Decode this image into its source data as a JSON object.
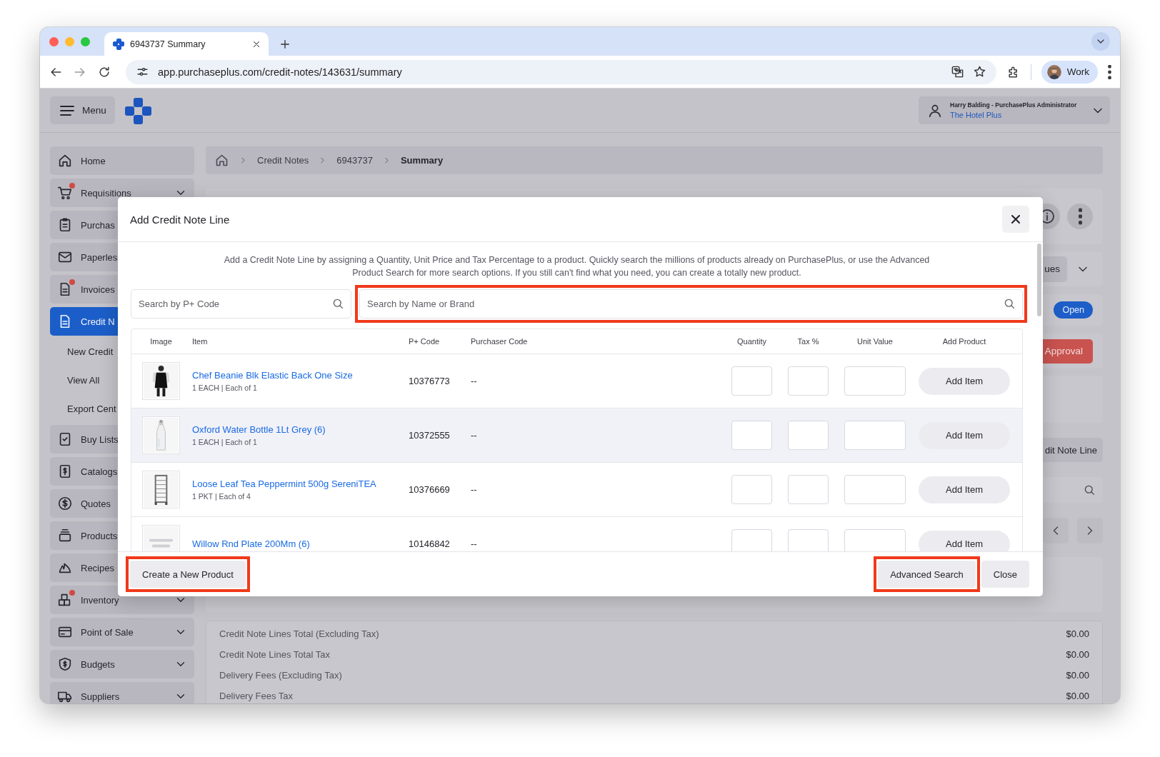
{
  "browser": {
    "tab": {
      "title": "6943737 Summary",
      "selected": true
    },
    "url": "app.purchaseplus.com/credit-notes/143631/summary",
    "profile": "Work"
  },
  "header": {
    "menu": "Menu",
    "user_name": "Harry Balding - PurchasePlus Administrator",
    "organisation": "The Hotel Plus"
  },
  "sidebar": {
    "items": [
      {
        "label": "Home",
        "selected": false,
        "alert": false,
        "chevron": false
      },
      {
        "label": "Requisitions",
        "selected": false,
        "alert": true,
        "chevron": true
      },
      {
        "label": "Purchas",
        "selected": false,
        "alert": false,
        "chevron": false
      },
      {
        "label": "Paperles",
        "selected": false,
        "alert": false,
        "chevron": false
      },
      {
        "label": "Invoices",
        "selected": false,
        "alert": true,
        "chevron": false
      },
      {
        "label": "Credit N",
        "selected": true,
        "alert": false,
        "chevron": false,
        "children": [
          {
            "label": "New Credit"
          },
          {
            "label": "View All"
          },
          {
            "label": "Export Cent"
          }
        ]
      },
      {
        "label": "Buy Lists",
        "selected": false,
        "alert": false,
        "chevron": false
      },
      {
        "label": "Catalogs",
        "selected": false,
        "alert": false,
        "chevron": false
      },
      {
        "label": "Quotes",
        "selected": false,
        "alert": false,
        "chevron": false
      },
      {
        "label": "Products",
        "selected": false,
        "alert": false,
        "chevron": false
      },
      {
        "label": "Recipes",
        "selected": false,
        "alert": false,
        "chevron": false
      },
      {
        "label": "Inventory",
        "selected": false,
        "alert": true,
        "chevron": true
      },
      {
        "label": "Point of Sale",
        "selected": false,
        "alert": false,
        "chevron": true
      },
      {
        "label": "Budgets",
        "selected": false,
        "alert": false,
        "chevron": true
      },
      {
        "label": "Suppliers",
        "selected": false,
        "alert": false,
        "chevron": true
      }
    ]
  },
  "breadcrumb": [
    {
      "label": "Credit Notes",
      "kind": "link"
    },
    {
      "label": "6943737",
      "kind": "link"
    },
    {
      "label": "Summary",
      "kind": "current"
    }
  ],
  "page": {
    "filter_button": "ues",
    "status": "Open",
    "approval_button": "Approval",
    "add_line_button": "dit Note Line",
    "summary": [
      {
        "label": "Credit Note Lines Total (Excluding Tax)",
        "value": "$0.00"
      },
      {
        "label": "Credit Note Lines Total Tax",
        "value": "$0.00"
      },
      {
        "label": "Delivery Fees (Excluding Tax)",
        "value": "$0.00"
      },
      {
        "label": "Delivery Fees Tax",
        "value": "$0.00"
      }
    ]
  },
  "modal": {
    "title": "Add Credit Note Line",
    "description": "Add a Credit Note Line by assigning a Quantity, Unit Price and Tax Percentage to a product. Quickly search the millions of products already on PurchasePlus, or use the Advanced Product Search for more search options. If you still can't find what you need, you can create a totally new product.",
    "code_search": {
      "placeholder": "Search by P+ Code",
      "highlighted": false
    },
    "name_search": {
      "placeholder": "Search by Name or Brand",
      "highlighted": true
    },
    "columns": [
      "Image",
      "Item",
      "P+ Code",
      "Purchaser Code",
      "Quantity",
      "Tax %",
      "Unit Value",
      "Add Product"
    ],
    "rows": [
      {
        "item": "Chef Beanie Blk Elastic Back One Size",
        "pack": "1 EACH | Each of 1",
        "p_code": "10376773",
        "purchaser_code": "--",
        "button": "Add Item",
        "hovered": false
      },
      {
        "item": "Oxford Water Bottle 1Lt Grey (6)",
        "pack": "1 EACH | Each of 1",
        "p_code": "10372555",
        "purchaser_code": "--",
        "button": "Add Item",
        "hovered": true
      },
      {
        "item": "Loose Leaf Tea Peppermint 500g SereniTEA",
        "pack": "1 PKT | Each of 4",
        "p_code": "10376669",
        "purchaser_code": "--",
        "button": "Add Item",
        "hovered": false
      },
      {
        "image": {
          "kind": "placeholder"
        },
        "item": "Willow Rnd Plate 200Mm (6)",
        "p_code": "10146842",
        "purchaser_code": "--",
        "button": "Add Item",
        "hovered": false
      }
    ],
    "footer_left": [
      {
        "label": "Create a New Product",
        "highlighted": true
      }
    ],
    "footer_right": [
      {
        "label": "Advanced Search",
        "highlighted": true
      },
      {
        "label": "Close",
        "highlighted": false
      }
    ]
  }
}
